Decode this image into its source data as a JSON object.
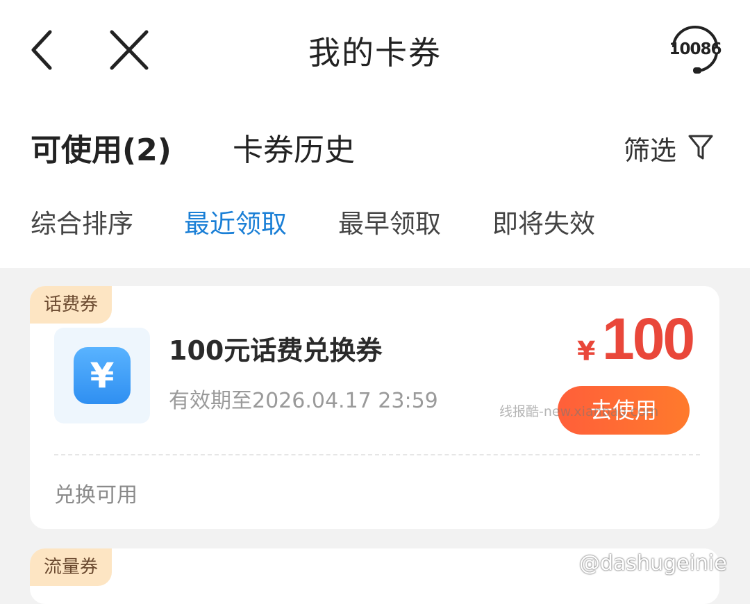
{
  "header": {
    "title": "我的卡券",
    "service_number": "10086"
  },
  "tabs": {
    "available": "可使用(2)",
    "history": "卡券历史",
    "filter": "筛选"
  },
  "sort": {
    "options": [
      "综合排序",
      "最近领取",
      "最早领取",
      "即将失效"
    ],
    "active_index": 1
  },
  "coupons": [
    {
      "tag": "话费券",
      "icon_symbol": "¥",
      "name": "100元话费兑换券",
      "validity": "有效期至2026.04.17 23:59",
      "price_symbol": "¥",
      "price": "100",
      "button": "去使用",
      "note": "兑换可用"
    },
    {
      "tag": "流量券"
    }
  ],
  "watermarks": {
    "site": "线报酷-new.xianbao.com",
    "weibo": "@dashugeinie"
  },
  "colors": {
    "accent_blue": "#1a7fd6",
    "price_red": "#e9473a",
    "button_orange": "#ff6a33",
    "tag_bg": "#fde5c3"
  }
}
